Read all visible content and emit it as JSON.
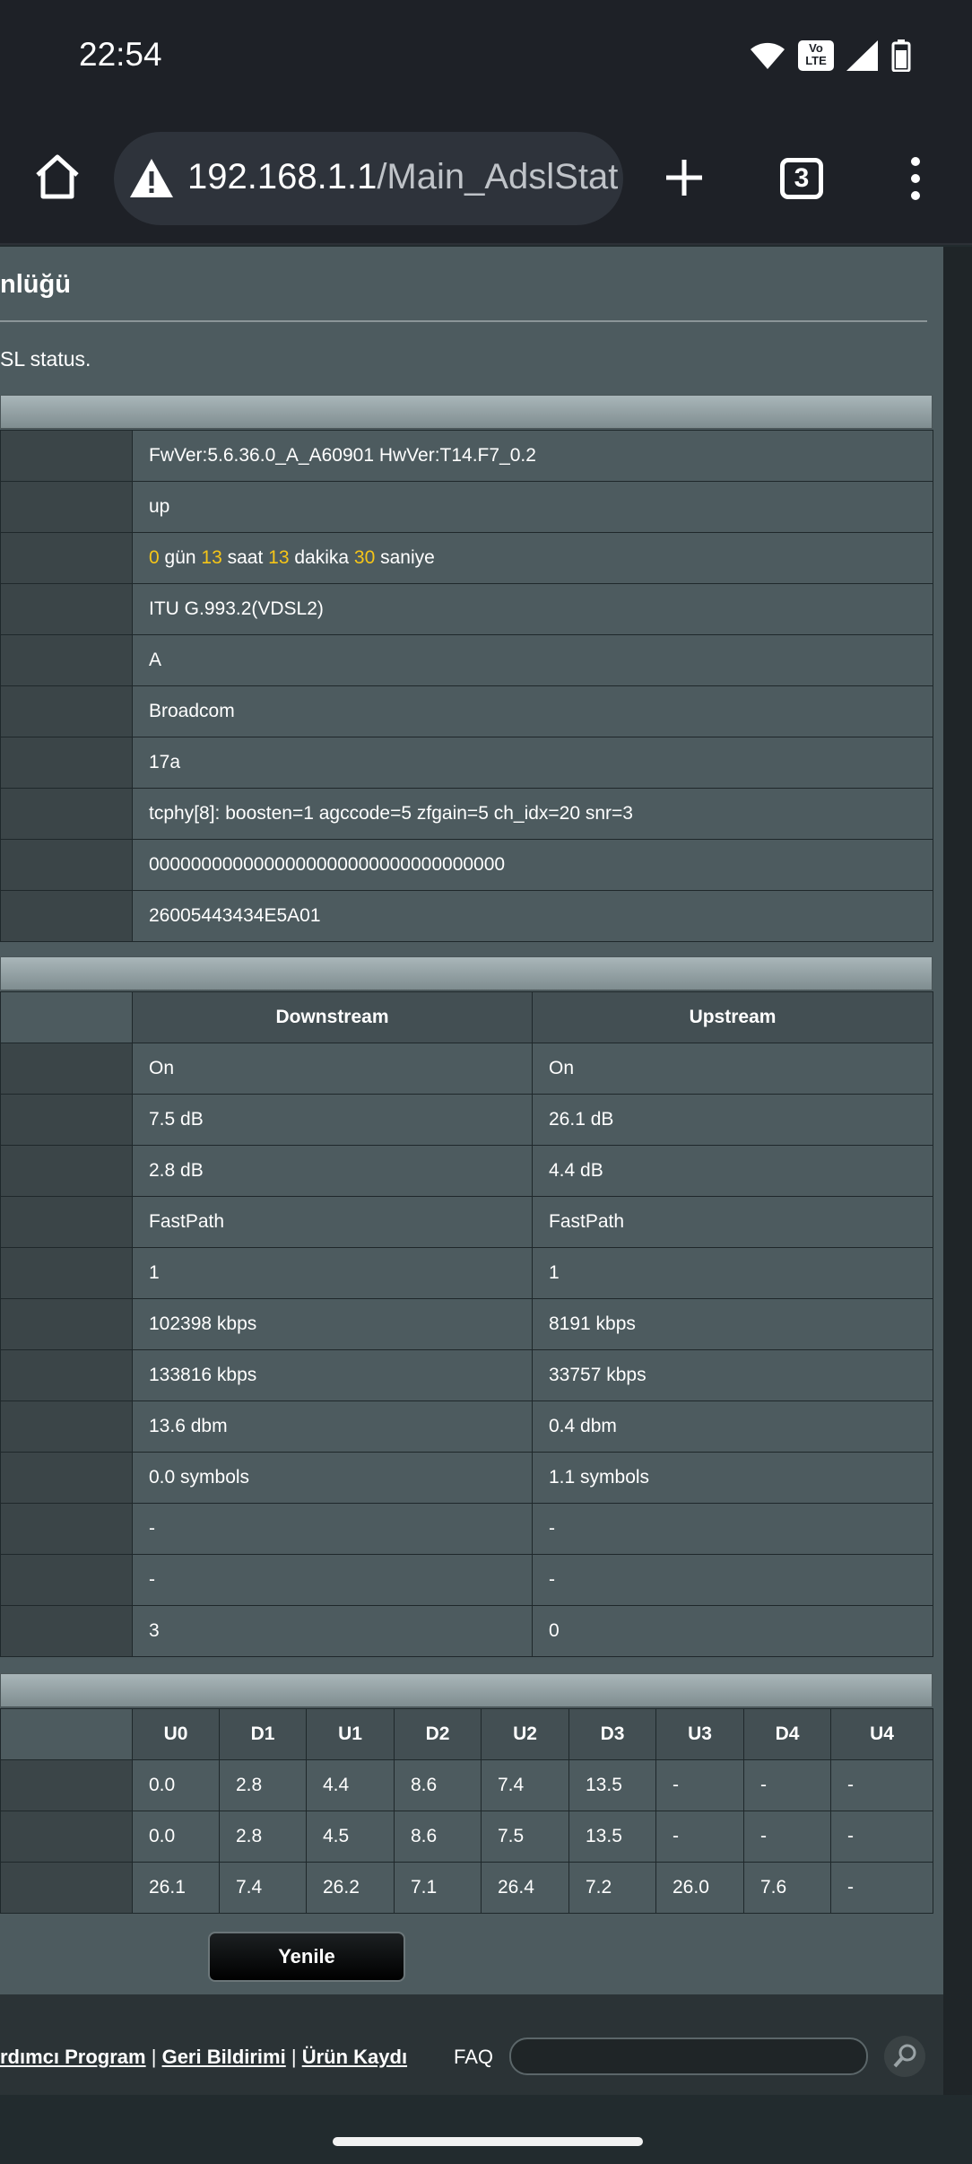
{
  "status_bar": {
    "time": "22:54",
    "volte_label_top": "Vo",
    "volte_label_bottom": "LTE",
    "icons": [
      "wifi-icon",
      "volte-icon",
      "signal-icon",
      "battery-icon"
    ]
  },
  "browser": {
    "url_host": "192.168.1.1",
    "url_path": "/Main_AdslStat",
    "tab_count": "3",
    "icons": [
      "home-icon",
      "warning-icon",
      "plus-icon",
      "menu-dots-icon"
    ]
  },
  "page": {
    "heading": "nlüğü",
    "description": "SL status.",
    "info_rows": [
      "FwVer:5.6.36.0_A_A60901 HwVer:T14.F7_0.2",
      "up",
      null,
      "ITU G.993.2(VDSL2)",
      "A",
      "Broadcom",
      "17a",
      "tcphy[8]: boosten=1 agccode=5 zfgain=5 ch_idx=20 snr=3",
      "0000000000000000000000000000000000",
      "26005443434E5A01"
    ],
    "uptime": {
      "days": "0",
      "days_label": "gün",
      "hours": "13",
      "hours_label": "saat",
      "minutes": "13",
      "minutes_label": "dakika",
      "seconds": "30",
      "seconds_label": "saniye"
    },
    "stats": {
      "headers": [
        "Downstream",
        "Upstream"
      ],
      "rows": [
        [
          "On",
          "On"
        ],
        [
          "7.5 dB",
          "26.1 dB"
        ],
        [
          "2.8 dB",
          "4.4 dB"
        ],
        [
          "FastPath",
          "FastPath"
        ],
        [
          "1",
          "1"
        ],
        [
          "102398 kbps",
          "8191 kbps"
        ],
        [
          "133816 kbps",
          "33757 kbps"
        ],
        [
          "13.6 dbm",
          "0.4 dbm"
        ],
        [
          "0.0 symbols",
          "1.1 symbols"
        ],
        [
          "-",
          "-"
        ],
        [
          "-",
          "-"
        ],
        [
          "3",
          "0"
        ]
      ]
    },
    "bands": {
      "headers": [
        "U0",
        "D1",
        "U1",
        "D2",
        "U2",
        "D3",
        "U3",
        "D4",
        "U4"
      ],
      "rows": [
        [
          "0.0",
          "2.8",
          "4.4",
          "8.6",
          "7.4",
          "13.5",
          "-",
          "-",
          "-"
        ],
        [
          "0.0",
          "2.8",
          "4.5",
          "8.6",
          "7.5",
          "13.5",
          "-",
          "-",
          "-"
        ],
        [
          "26.1",
          "7.4",
          "26.2",
          "7.1",
          "26.4",
          "7.2",
          "26.0",
          "7.6",
          "-"
        ]
      ]
    },
    "refresh_label": "Yenile",
    "footer": {
      "link1": "rdımcı Program",
      "sep": "|",
      "link2": "Geri Bildirimi",
      "link3": "Ürün Kaydı",
      "faq_label": "FAQ"
    }
  },
  "colors": {
    "uptime_number": "#f5c518",
    "upstream_band": "#4fc3f7",
    "downstream_band": "#f59a23",
    "panel_bg": "#4d5b5f",
    "label_bg": "#3b4548"
  }
}
